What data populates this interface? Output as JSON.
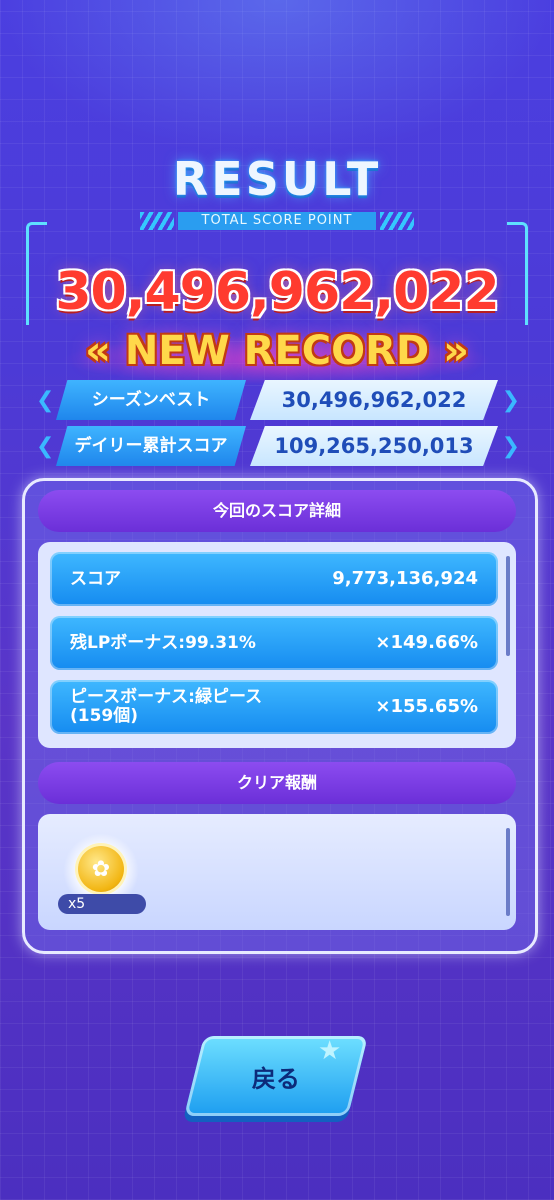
{
  "header": {
    "title": "RESULT",
    "subtitle": "TOTAL SCORE POINT",
    "total_score": "30,496,962,022",
    "new_record": "« NEW RECORD »"
  },
  "stats": [
    {
      "label": "シーズンベスト",
      "value": "30,496,962,022"
    },
    {
      "label": "デイリー累計スコア",
      "value": "109,265,250,013"
    }
  ],
  "details": {
    "header": "今回のスコア詳細",
    "rows": [
      {
        "label": "スコア",
        "value": "9,773,136,924"
      },
      {
        "label": "残LPボーナス:99.31%",
        "value": "×149.66%"
      },
      {
        "label": "ピースボーナス:緑ピース\n(159個)",
        "value": "×155.65%"
      }
    ]
  },
  "rewards": {
    "header": "クリア報酬",
    "items": [
      {
        "icon": "gold-medal-icon",
        "qty": "x5"
      }
    ]
  },
  "buttons": {
    "back": "戻る"
  },
  "colors": {
    "score_red": "#ff3b2f",
    "record_yellow": "#ffd84a",
    "accent_blue": "#1f86ec",
    "section_purple": "#7a3de6"
  }
}
